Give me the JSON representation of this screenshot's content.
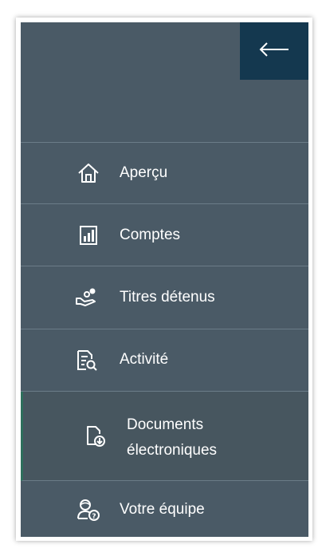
{
  "nav": {
    "collapse_icon": "arrow-left-icon",
    "items": [
      {
        "label": "Aperçu",
        "icon": "home-icon"
      },
      {
        "label": "Comptes",
        "icon": "account-report-icon"
      },
      {
        "label": "Titres détenus",
        "icon": "holdings-hand-icon"
      },
      {
        "label": "Activité",
        "icon": "document-search-icon"
      },
      {
        "label_line1": "Documents",
        "label_line2": "électroniques",
        "icon": "document-download-icon"
      },
      {
        "label": "Votre équipe",
        "icon": "team-support-icon"
      }
    ]
  },
  "colors": {
    "panel": "#4a5a66",
    "collapse_button": "#14384f",
    "divider": "#6b7c88",
    "text": "#ffffff",
    "active_accent": "#2e6f5c"
  }
}
